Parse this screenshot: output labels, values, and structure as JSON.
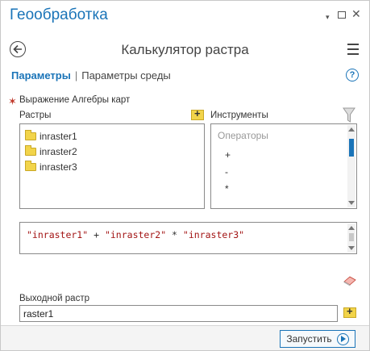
{
  "window": {
    "title": "Геообработка",
    "pin": "▾",
    "close": "✕"
  },
  "header": {
    "tool_title": "Калькулятор растра"
  },
  "tabs": [
    {
      "label": "Параметры",
      "active": true
    },
    {
      "label": "Параметры среды",
      "active": false
    }
  ],
  "tab_separator": "|",
  "help": "?",
  "expression": {
    "required_mark": "✶",
    "label": "Выражение Алгебры карт",
    "rasters_label": "Растры",
    "tools_label": "Инструменты",
    "rasters": [
      "inraster1",
      "inraster2",
      "inraster3"
    ],
    "operators_header": "Операторы",
    "operators": [
      "+",
      "-",
      "*"
    ],
    "tokens": [
      {
        "text": "\"inraster1\"",
        "kind": "s"
      },
      {
        "text": " + ",
        "kind": "o"
      },
      {
        "text": "\"inraster2\"",
        "kind": "s"
      },
      {
        "text": " * ",
        "kind": "o"
      },
      {
        "text": "\"inraster3\"",
        "kind": "s"
      }
    ]
  },
  "output": {
    "label": "Выходной растр",
    "value": "raster1"
  },
  "footer": {
    "run_label": "Запустить"
  },
  "colors": {
    "accent": "#1a74b8",
    "string": "#a31515",
    "folder": "#f2d44a"
  }
}
